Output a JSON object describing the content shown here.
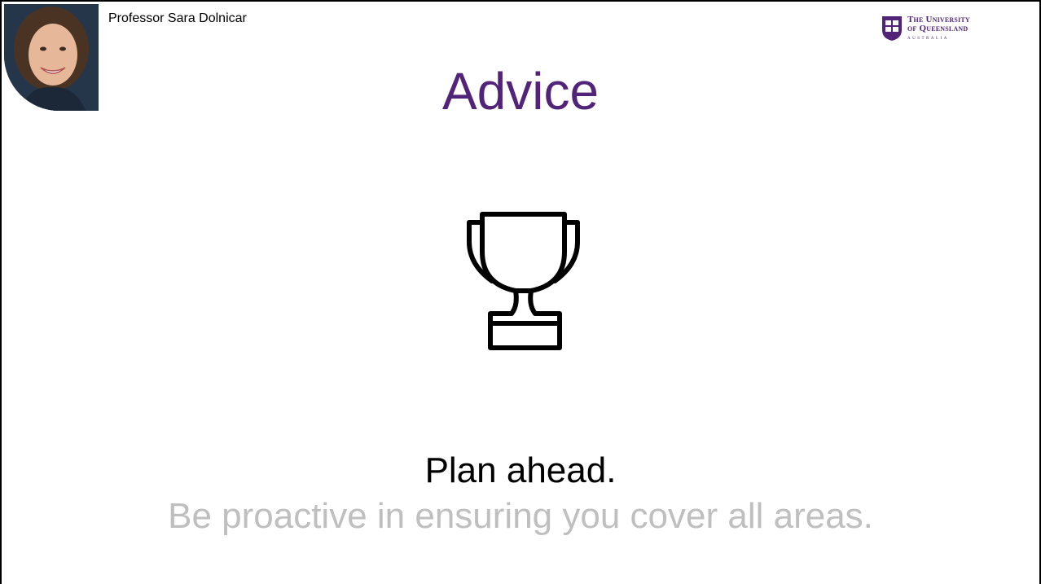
{
  "header": {
    "presenter_name": "Professor Sara Dolnicar",
    "logo": {
      "line1": "The University",
      "line2": "of Queensland",
      "line3": "AUSTRALIA",
      "icon": "uq-crest-icon"
    }
  },
  "slide": {
    "title": "Advice",
    "icon": "trophy-icon",
    "main_text": "Plan ahead.",
    "sub_text": "Be proactive in ensuring you cover all areas."
  },
  "colors": {
    "title": "#51247a",
    "sub_text": "#bfbfbf",
    "border": "#000000"
  }
}
